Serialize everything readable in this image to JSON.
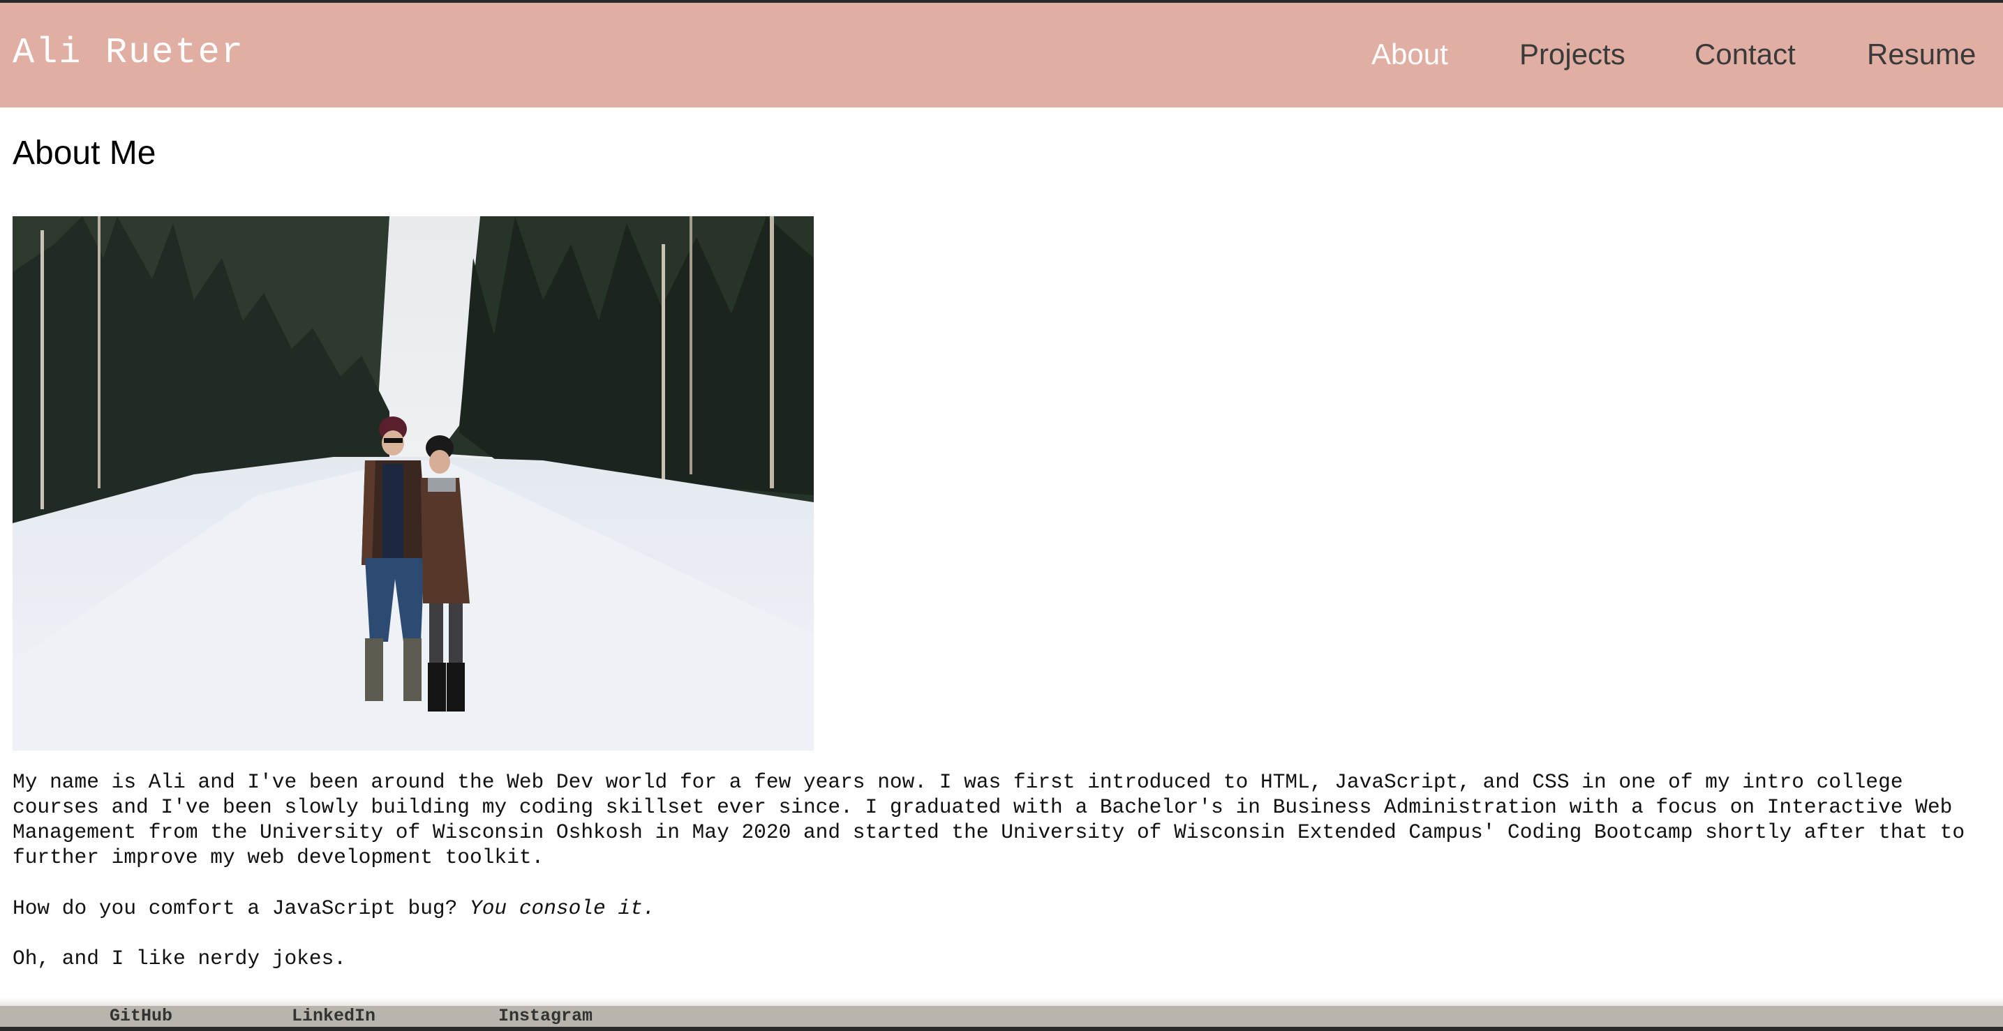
{
  "header": {
    "site_title": "Ali Rueter",
    "nav": [
      {
        "label": "About",
        "active": true
      },
      {
        "label": "Projects",
        "active": false
      },
      {
        "label": "Contact",
        "active": false
      },
      {
        "label": "Resume",
        "active": false
      }
    ]
  },
  "main": {
    "title": "About Me",
    "photo_alt": "Ali and a companion standing on a snowy road between pine trees",
    "bio": "My name is Ali and I've been around the Web Dev world for a few years now. I was first introduced to HTML, JavaScript, and CSS in one of my intro college courses and I've been slowly building my coding skillset ever since. I graduated with a Bachelor's in Business Administration with a focus on Interactive Web Management from the University of Wisconsin Oshkosh in May 2020 and started the University of Wisconsin Extended Campus' Coding Bootcamp shortly after that to further improve my web development toolkit.",
    "joke_question": "How do you comfort a JavaScript bug?",
    "joke_answer": "You console it.",
    "closing": "Oh, and I like nerdy jokes."
  },
  "footer": {
    "links": [
      "GitHub",
      "LinkedIn",
      "Instagram"
    ]
  },
  "colors": {
    "header_bg": "#e0aea2",
    "active_nav": "#ffffff",
    "footer_bg": "#b9b5ad"
  }
}
